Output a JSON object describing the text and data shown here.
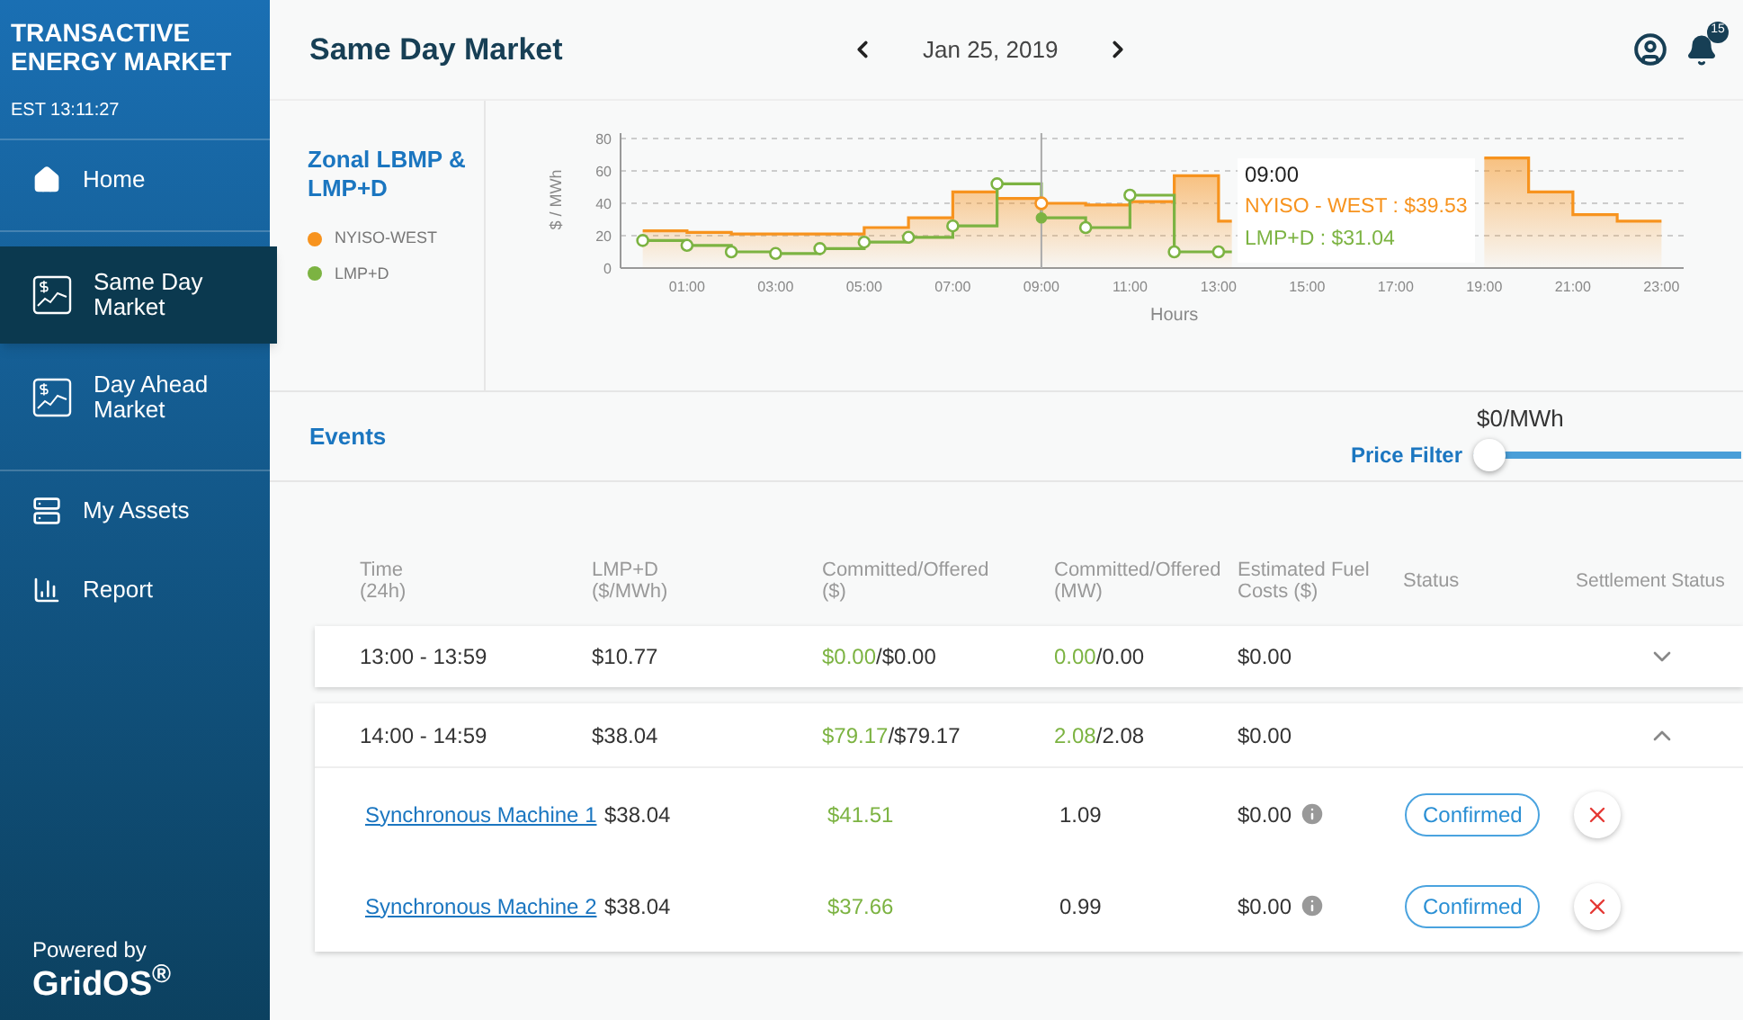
{
  "sidebar": {
    "title": "TRANSACTIVE ENERGY MARKET",
    "clock": "EST 13:11:27",
    "items": [
      {
        "label": "Home",
        "kind": "home",
        "selected": false
      },
      {
        "label": "Same Day Market",
        "kind": "chart",
        "selected": true
      },
      {
        "label": "Day Ahead Market",
        "kind": "chart",
        "selected": false
      },
      {
        "label": "My Assets",
        "kind": "server",
        "selected": false
      },
      {
        "label": "Report",
        "kind": "report",
        "selected": false
      }
    ],
    "powered_by": "Powered by",
    "brand": "GridOS$^{®}$"
  },
  "header": {
    "title": "Same Day Market",
    "date": "Jan 25, 2019",
    "notifications": "15"
  },
  "chart_panel": {
    "title": "Zonal LBMP & LMP+D",
    "tooltip": {
      "time": "09:00",
      "lines": [
        {
          "text": "NYISO - WEST : $39.53",
          "color": "#f7931e"
        },
        {
          "text": "LMP+D : $31.04",
          "color": "#7cb342"
        }
      ]
    },
    "chart_data": {
      "type": "line",
      "grid": true,
      "xlabel": "Hours",
      "ylabel": "$ / MWh",
      "x": [
        0,
        1,
        1,
        2,
        2,
        3,
        3,
        4,
        4,
        5,
        5,
        6,
        6,
        7,
        7,
        8,
        8,
        9,
        9,
        10,
        10,
        11,
        11,
        12,
        12,
        13,
        13,
        13.3,
        19,
        20,
        20,
        21,
        21,
        22,
        22,
        23
      ],
      "series": [
        {
          "name": "NYISO-WEST",
          "color": "#f7931e",
          "type": "area",
          "marker": "none",
          "values": [
            23,
            23,
            22,
            22,
            21,
            21,
            21,
            21,
            21,
            21,
            25,
            25,
            31,
            31,
            47,
            47,
            43,
            43,
            40,
            40,
            39,
            39,
            41,
            41,
            57,
            57,
            29,
            29,
            68,
            68,
            47,
            47,
            33,
            33,
            29,
            29
          ]
        },
        {
          "name": "LMP+D",
          "color": "#7cb342",
          "type": "line",
          "marker": "circle",
          "values": [
            17,
            17,
            14,
            14,
            10,
            10,
            9,
            9,
            12,
            12,
            16,
            16,
            19,
            19,
            26,
            26,
            52,
            52,
            31,
            31,
            25,
            25,
            45,
            45,
            10,
            10,
            10,
            10,
            null,
            null,
            null,
            null,
            null,
            null,
            null,
            null
          ]
        }
      ],
      "ref_lines": [
        {
          "axis": "x",
          "value": 9
        }
      ],
      "xlim": [
        -0.5,
        23.5
      ],
      "ylim": [
        0,
        80
      ],
      "yticks": [
        0,
        20,
        40,
        60,
        80
      ],
      "xticks": [
        {
          "value": 1,
          "label": "01:00"
        },
        {
          "value": 3,
          "label": "03:00"
        },
        {
          "value": 5,
          "label": "05:00"
        },
        {
          "value": 7,
          "label": "07:00"
        },
        {
          "value": 9,
          "label": "09:00"
        },
        {
          "value": 11,
          "label": "11:00"
        },
        {
          "value": 13,
          "label": "13:00"
        },
        {
          "value": 15,
          "label": "15:00"
        },
        {
          "value": 17,
          "label": "17:00"
        },
        {
          "value": 19,
          "label": "19:00"
        },
        {
          "value": 21,
          "label": "21:00"
        },
        {
          "value": 23,
          "label": "23:00"
        }
      ]
    }
  },
  "events": {
    "title": "Events",
    "price_filter": {
      "label": "Price Filter",
      "reading": "$0/MWh",
      "level": 0
    }
  },
  "table": {
    "columns": [
      "Time (24h)",
      "LMP+D ($/MWh)",
      "Committed/Offered ($)",
      "Committed/Offered (MW)",
      "Estimated Fuel Costs ($)",
      "Status",
      "Settlement Status"
    ],
    "rows": [
      {
        "time": "13:00 - 13:59",
        "lmp": "$10.77",
        "committed_usd": "$0.00",
        "offered_usd": "/$0.00",
        "committed_mw": "0.00",
        "offered_mw": "/0.00",
        "fuel": "$0.00",
        "expanded": false,
        "children": []
      },
      {
        "time": "14:00 - 14:59",
        "lmp": "$38.04",
        "committed_usd": "$79.17",
        "offered_usd": "/$79.17",
        "committed_mw": "2.08",
        "offered_mw": "/2.08",
        "fuel": "$0.00",
        "expanded": true,
        "children": [
          {
            "name": "Synchronous Machine 1",
            "lmp": "$38.04",
            "committed_usd": "$41.51",
            "mw": "1.09",
            "fuel": "$0.00",
            "status": "Confirmed"
          },
          {
            "name": "Synchronous Machine 2",
            "lmp": "$38.04",
            "committed_usd": "$37.66",
            "mw": "0.99",
            "fuel": "$0.00",
            "status": "Confirmed"
          }
        ]
      }
    ]
  }
}
